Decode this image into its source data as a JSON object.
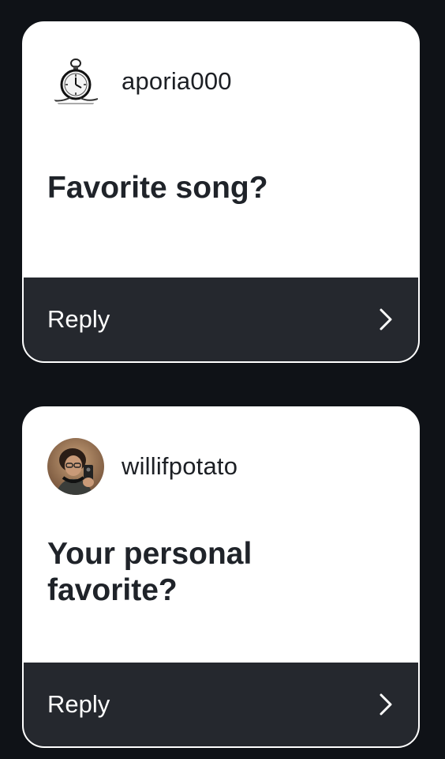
{
  "colors": {
    "background": "#0f1217",
    "card": "#ffffff",
    "reply_bar": "#25282e",
    "text_dark": "#1f2329",
    "text_light": "#ffffff"
  },
  "cards": [
    {
      "username": "aporia000",
      "avatar_icon": "pocket-watch-icon",
      "question": "Favorite song?",
      "reply_label": "Reply",
      "reply_icon": "chevron-right-icon"
    },
    {
      "username": "willifpotato",
      "avatar_icon": "user-photo-avatar",
      "question": "Your personal favorite?",
      "reply_label": "Reply",
      "reply_icon": "chevron-right-icon"
    }
  ]
}
